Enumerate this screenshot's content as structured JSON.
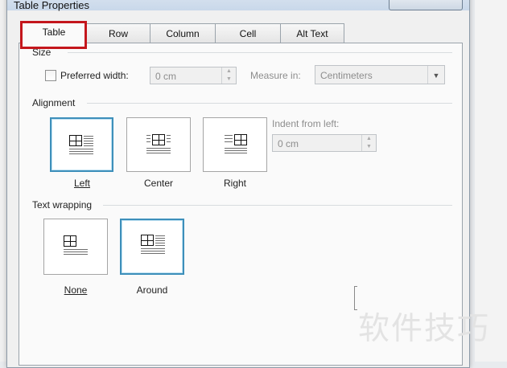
{
  "dialog": {
    "title": "Table Properties"
  },
  "tabs": [
    {
      "label": "Table",
      "active": true
    },
    {
      "label": "Row",
      "active": false
    },
    {
      "label": "Column",
      "active": false
    },
    {
      "label": "Cell",
      "active": false
    },
    {
      "label": "Alt Text",
      "active": false
    }
  ],
  "size": {
    "group_label": "Size",
    "preferred_width_label": "Preferred width:",
    "preferred_width_checked": false,
    "preferred_width_value": "0 cm",
    "measure_label": "Measure in:",
    "measure_value": "Centimeters"
  },
  "alignment": {
    "group_label": "Alignment",
    "options": [
      {
        "label": "Left",
        "selected": true
      },
      {
        "label": "Center",
        "selected": false
      },
      {
        "label": "Right",
        "selected": false
      }
    ],
    "indent_label": "Indent from left:",
    "indent_value": "0 cm"
  },
  "text_wrapping": {
    "group_label": "Text wrapping",
    "options": [
      {
        "label": "None",
        "selected": false
      },
      {
        "label": "Around",
        "selected": true
      }
    ]
  },
  "watermark": "软件技巧",
  "colors": {
    "highlight": "#c4161c",
    "selection": "#3d8fba"
  }
}
